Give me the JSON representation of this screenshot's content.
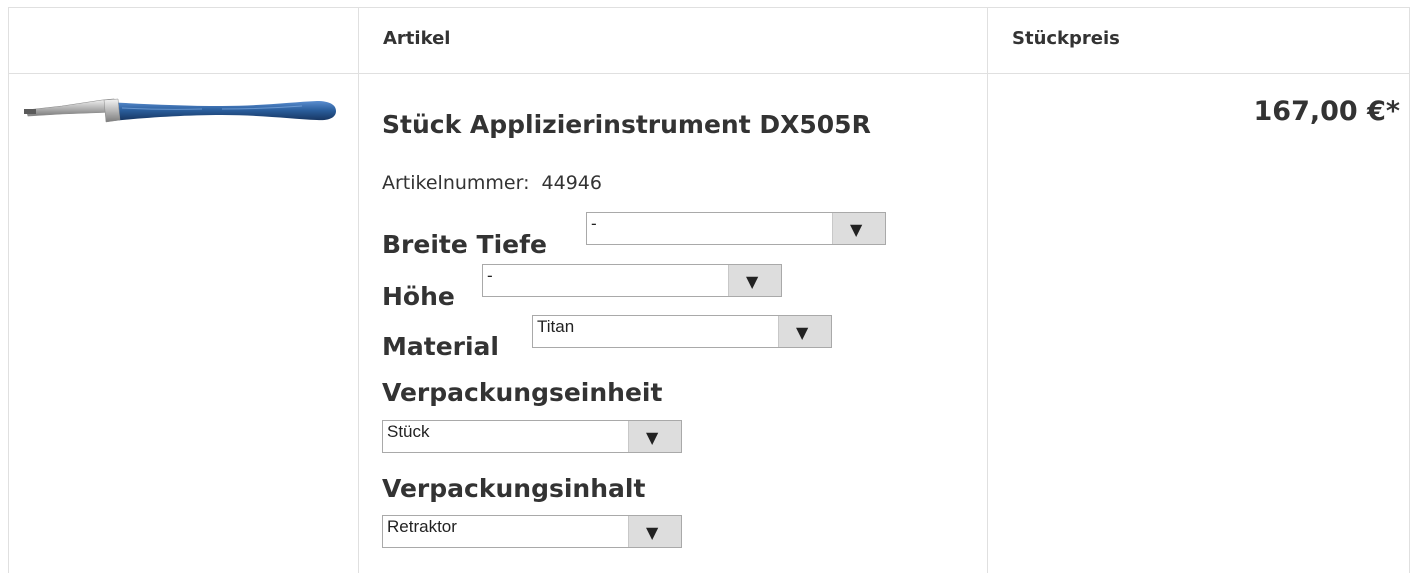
{
  "table": {
    "headers": {
      "article": "Artikel",
      "unit_price": "Stückpreis"
    }
  },
  "product": {
    "image_alt": "Applizierinstrument DX505R",
    "title": "Stück Applizierinstrument DX505R",
    "article_number_label": "Artikelnummer:",
    "article_number": "44946",
    "options": [
      {
        "label": "Breite Tiefe",
        "value": "-"
      },
      {
        "label": "Höhe",
        "value": "-"
      },
      {
        "label": "Material",
        "value": "Titan"
      },
      {
        "label": "Verpackungseinheit",
        "value": "Stück"
      },
      {
        "label": "Verpackungsinhalt",
        "value": "Retraktor"
      }
    ],
    "price": "167,00 €*"
  },
  "icons": {
    "dropdown": "triangle-down-icon"
  },
  "colors": {
    "instrument_blue": "#2b5f9e",
    "border": "#e0e0e0",
    "select_button": "#dddddd"
  }
}
